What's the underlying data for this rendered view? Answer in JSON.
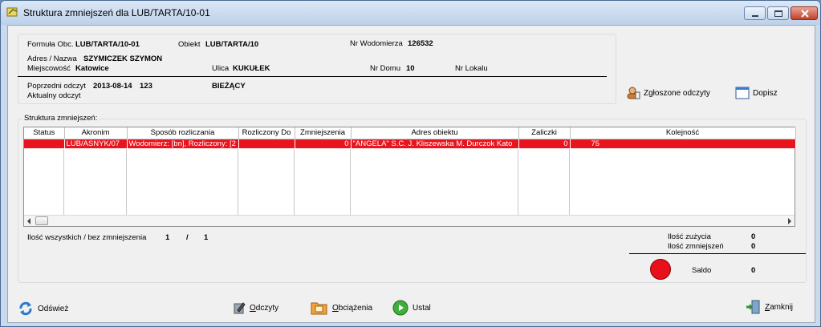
{
  "window": {
    "title": "Struktura zmniejszeń dla LUB/TARTA/10-01"
  },
  "info": {
    "formula_label": "Formuła Obc.",
    "formula_value": "LUB/TARTA/10-01",
    "obiekt_label": "Obiekt",
    "obiekt_value": "LUB/TARTA/10",
    "wodomierz_label": "Nr Wodomierza",
    "wodomierz_value": "126532",
    "adres_label": "Adres / Nazwa",
    "adres_value": "SZYMICZEK SZYMON",
    "miejscowosc_label": "Miejscowość",
    "miejscowosc_value": "Katowice",
    "ulica_label": "Ulica",
    "ulica_value": "KUKUŁEK",
    "nr_domu_label": "Nr Domu",
    "nr_domu_value": "10",
    "nr_lokalu_label": "Nr Lokalu",
    "poprzedni_label": "Poprzedni odczyt",
    "poprzedni_date": "2013-08-14",
    "poprzedni_value": "123",
    "biezacy_label": "BIEŻĄCY",
    "aktualny_label": "Aktualny odczyt"
  },
  "actions": {
    "zgloszone_label": "Zgłoszone odczyty",
    "dopisz_label": "Dopisz"
  },
  "table": {
    "group_label": "Struktura zmniejszeń:",
    "columns": [
      "Status",
      "Akronim",
      "Sposób rozliczania",
      "Rozliczony Do",
      "Zmniejszenia",
      "Adres obiektu",
      "Zaliczki",
      "Kolejność"
    ],
    "rows": [
      {
        "status": "",
        "akronim": "LUB/ASNYK/07",
        "sposob": "Wodomierz: [bn], Rozliczony: [2",
        "rozliczony_do": "",
        "zmniejszenia": "0",
        "adres": "\"ANGELA\" S.C. J. Kliszewska M. Durczok Kato",
        "zaliczki": "0",
        "kolejnosc": "75"
      }
    ]
  },
  "stats": {
    "ilosc_label": "Ilość wszystkich / bez zmniejszenia",
    "ilosc_all": "1",
    "separator": "/",
    "ilosc_bez": "1",
    "zuzycia_label": "Ilość zużycia",
    "zuzycia_value": "0",
    "zmniejszen_label": "Ilość zmniejszeń",
    "zmniejszen_value": "0",
    "saldo_label": "Saldo",
    "saldo_value": "0"
  },
  "bottom": {
    "odswiez": "Odśwież",
    "odczyty": "Odczyty",
    "obciazenia": "Obciążenia",
    "ustal": "Ustal",
    "zamknij": "Zamknij"
  },
  "colors": {
    "row_selected": "#e8141e",
    "saldo_indicator": "#e8101a"
  }
}
